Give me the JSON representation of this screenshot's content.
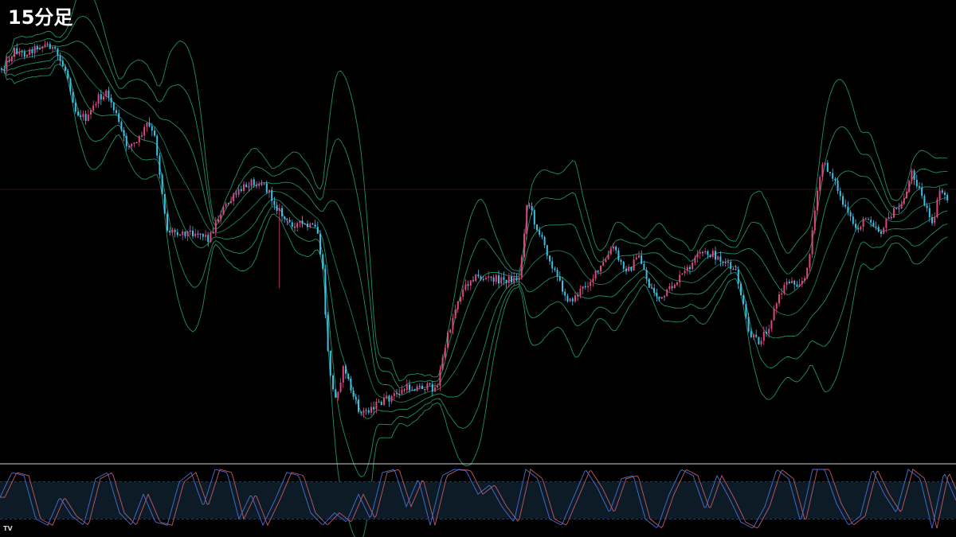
{
  "title": "15分足",
  "logo": "TV",
  "colors": {
    "background": "#000000",
    "candle_up": "#e0457f",
    "candle_down": "#3fbfe3",
    "candle_doji": "#b08ad6",
    "band": "#1f8f6a",
    "band_mid": "#1a7a5c",
    "osc_k": "#4a6fd8",
    "osc_d": "#c25a6a",
    "osc_zone": "#0c1b26",
    "divider": "#d0d0d0",
    "level_line": "#2a0f0f"
  },
  "chart_data": [
    {
      "type": "candlestick",
      "title": "15分足",
      "price_anchors": [
        [
          0,
          88
        ],
        [
          8,
          80
        ],
        [
          18,
          63
        ],
        [
          30,
          68
        ],
        [
          48,
          58
        ],
        [
          62,
          56
        ],
        [
          72,
          70
        ],
        [
          84,
          92
        ],
        [
          95,
          140
        ],
        [
          110,
          150
        ],
        [
          122,
          124
        ],
        [
          135,
          118
        ],
        [
          145,
          142
        ],
        [
          158,
          182
        ],
        [
          172,
          180
        ],
        [
          185,
          155
        ],
        [
          195,
          175
        ],
        [
          202,
          230
        ],
        [
          210,
          290
        ],
        [
          230,
          292
        ],
        [
          250,
          292
        ],
        [
          262,
          300
        ],
        [
          278,
          265
        ],
        [
          296,
          245
        ],
        [
          314,
          228
        ],
        [
          330,
          230
        ],
        [
          345,
          256
        ],
        [
          360,
          280
        ],
        [
          378,
          282
        ],
        [
          398,
          288
        ],
        [
          405,
          340
        ],
        [
          412,
          450
        ],
        [
          420,
          505
        ],
        [
          432,
          460
        ],
        [
          442,
          495
        ],
        [
          452,
          520
        ],
        [
          470,
          510
        ],
        [
          490,
          500
        ],
        [
          510,
          488
        ],
        [
          530,
          486
        ],
        [
          548,
          488
        ],
        [
          560,
          430
        ],
        [
          575,
          375
        ],
        [
          592,
          348
        ],
        [
          612,
          350
        ],
        [
          632,
          352
        ],
        [
          652,
          350
        ],
        [
          662,
          250
        ],
        [
          672,
          282
        ],
        [
          688,
          320
        ],
        [
          702,
          355
        ],
        [
          715,
          380
        ],
        [
          732,
          362
        ],
        [
          752,
          340
        ],
        [
          770,
          310
        ],
        [
          778,
          330
        ],
        [
          790,
          340
        ],
        [
          802,
          320
        ],
        [
          815,
          360
        ],
        [
          830,
          378
        ],
        [
          845,
          358
        ],
        [
          860,
          342
        ],
        [
          880,
          318
        ],
        [
          895,
          320
        ],
        [
          910,
          330
        ],
        [
          925,
          345
        ],
        [
          940,
          420
        ],
        [
          952,
          430
        ],
        [
          965,
          410
        ],
        [
          975,
          380
        ],
        [
          988,
          352
        ],
        [
          1000,
          356
        ],
        [
          1012,
          350
        ],
        [
          1022,
          270
        ],
        [
          1032,
          205
        ],
        [
          1045,
          220
        ],
        [
          1060,
          262
        ],
        [
          1075,
          288
        ],
        [
          1090,
          272
        ],
        [
          1105,
          292
        ],
        [
          1118,
          270
        ],
        [
          1132,
          258
        ],
        [
          1145,
          215
        ],
        [
          1158,
          248
        ],
        [
          1170,
          285
        ],
        [
          1180,
          238
        ],
        [
          1190,
          250
        ]
      ],
      "bollinger_sigmas": [
        1,
        2,
        3
      ],
      "bollinger_period": 20,
      "horizontal_level_price_y": 238,
      "price_range_pixels_note": ""
    },
    {
      "type": "oscillator",
      "lines": [
        "%K",
        "%D"
      ],
      "overbought": 80,
      "oversold": 20,
      "ylim": [
        0,
        100
      ],
      "k_anchors": [
        [
          0,
          55
        ],
        [
          15,
          95
        ],
        [
          30,
          90
        ],
        [
          45,
          20
        ],
        [
          60,
          10
        ],
        [
          75,
          55
        ],
        [
          90,
          25
        ],
        [
          105,
          10
        ],
        [
          120,
          85
        ],
        [
          135,
          95
        ],
        [
          150,
          30
        ],
        [
          165,
          10
        ],
        [
          180,
          60
        ],
        [
          195,
          15
        ],
        [
          210,
          10
        ],
        [
          225,
          80
        ],
        [
          240,
          95
        ],
        [
          255,
          40
        ],
        [
          270,
          100
        ],
        [
          285,
          95
        ],
        [
          300,
          20
        ],
        [
          315,
          60
        ],
        [
          330,
          10
        ],
        [
          345,
          50
        ],
        [
          360,
          95
        ],
        [
          375,
          90
        ],
        [
          390,
          30
        ],
        [
          405,
          10
        ],
        [
          420,
          30
        ],
        [
          435,
          15
        ],
        [
          450,
          60
        ],
        [
          465,
          20
        ],
        [
          480,
          95
        ],
        [
          495,
          100
        ],
        [
          510,
          40
        ],
        [
          525,
          85
        ],
        [
          540,
          10
        ],
        [
          555,
          90
        ],
        [
          570,
          100
        ],
        [
          585,
          98
        ],
        [
          600,
          60
        ],
        [
          615,
          75
        ],
        [
          630,
          40
        ],
        [
          645,
          15
        ],
        [
          660,
          100
        ],
        [
          675,
          85
        ],
        [
          690,
          20
        ],
        [
          705,
          10
        ],
        [
          720,
          55
        ],
        [
          735,
          100
        ],
        [
          750,
          70
        ],
        [
          765,
          30
        ],
        [
          780,
          85
        ],
        [
          795,
          90
        ],
        [
          810,
          20
        ],
        [
          825,
          5
        ],
        [
          840,
          60
        ],
        [
          855,
          100
        ],
        [
          870,
          90
        ],
        [
          885,
          35
        ],
        [
          900,
          90
        ],
        [
          915,
          55
        ],
        [
          930,
          15
        ],
        [
          945,
          5
        ],
        [
          960,
          40
        ],
        [
          975,
          100
        ],
        [
          990,
          85
        ],
        [
          1005,
          15
        ],
        [
          1020,
          100
        ],
        [
          1035,
          100
        ],
        [
          1050,
          45
        ],
        [
          1065,
          10
        ],
        [
          1080,
          25
        ],
        [
          1095,
          100
        ],
        [
          1110,
          60
        ],
        [
          1125,
          30
        ],
        [
          1140,
          100
        ],
        [
          1155,
          85
        ],
        [
          1170,
          5
        ],
        [
          1185,
          95
        ],
        [
          1200,
          50
        ]
      ]
    }
  ]
}
